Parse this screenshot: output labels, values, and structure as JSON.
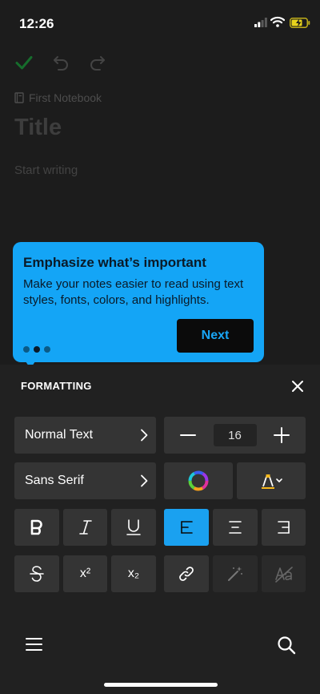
{
  "status": {
    "time": "12:26"
  },
  "editor": {
    "notebook": "First Notebook",
    "title_placeholder": "Title",
    "body_placeholder": "Start writing"
  },
  "tooltip": {
    "heading": "Emphasize what’s important",
    "body": "Make your notes easier to read using text styles, fonts, colors, and highlights.",
    "next_label": "Next",
    "pages": 3,
    "current_page": 2
  },
  "formatting": {
    "title": "FORMATTING",
    "text_style": "Normal Text",
    "font": "Sans Serif",
    "font_size": "16",
    "superscript_label": "x²",
    "subscript_label": "x₂",
    "active_alignment": "left"
  },
  "colors": {
    "accent": "#1aa1f0",
    "tooltip": "#14a5f6",
    "panel": "#212121",
    "button": "#343434"
  }
}
